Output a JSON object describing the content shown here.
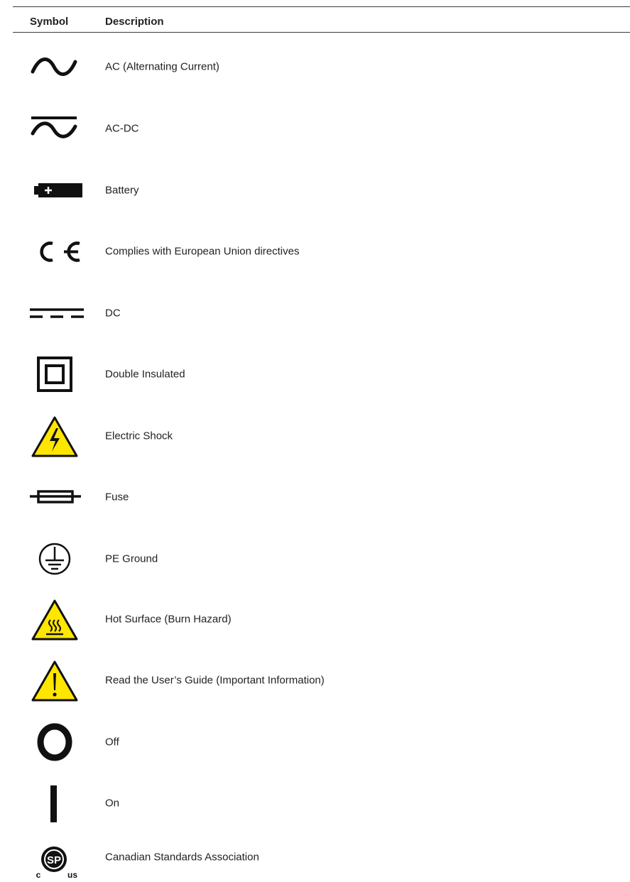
{
  "table": {
    "headers": {
      "symbol": "Symbol",
      "description": "Description"
    },
    "rows": [
      {
        "icon": "ac-icon",
        "description": "AC (Alternating Current)"
      },
      {
        "icon": "ac-dc-icon",
        "description": "AC-DC"
      },
      {
        "icon": "battery-icon",
        "description": "Battery"
      },
      {
        "icon": "ce-mark-icon",
        "description": "Complies with European Union directives"
      },
      {
        "icon": "dc-icon",
        "description": "DC"
      },
      {
        "icon": "double-insulated-icon",
        "description": "Double Insulated"
      },
      {
        "icon": "electric-shock-warning-icon",
        "description": "Electric Shock"
      },
      {
        "icon": "fuse-icon",
        "description": "Fuse"
      },
      {
        "icon": "pe-ground-icon",
        "description": "PE Ground"
      },
      {
        "icon": "hot-surface-warning-icon",
        "description": "Hot Surface (Burn Hazard)"
      },
      {
        "icon": "caution-warning-icon",
        "description": "Read the User’s Guide (Important Information)"
      },
      {
        "icon": "off-icon",
        "description": "Off"
      },
      {
        "icon": "on-icon",
        "description": "On"
      },
      {
        "icon": "csa-mark-icon",
        "description": "Canadian Standards Association",
        "mark_text": {
          "sp": "SP",
          "c": "c",
          "us": "us"
        }
      }
    ]
  },
  "colors": {
    "warning_yellow": "#ffe600",
    "ink": "#111111",
    "rule": "#3a3a3a"
  }
}
